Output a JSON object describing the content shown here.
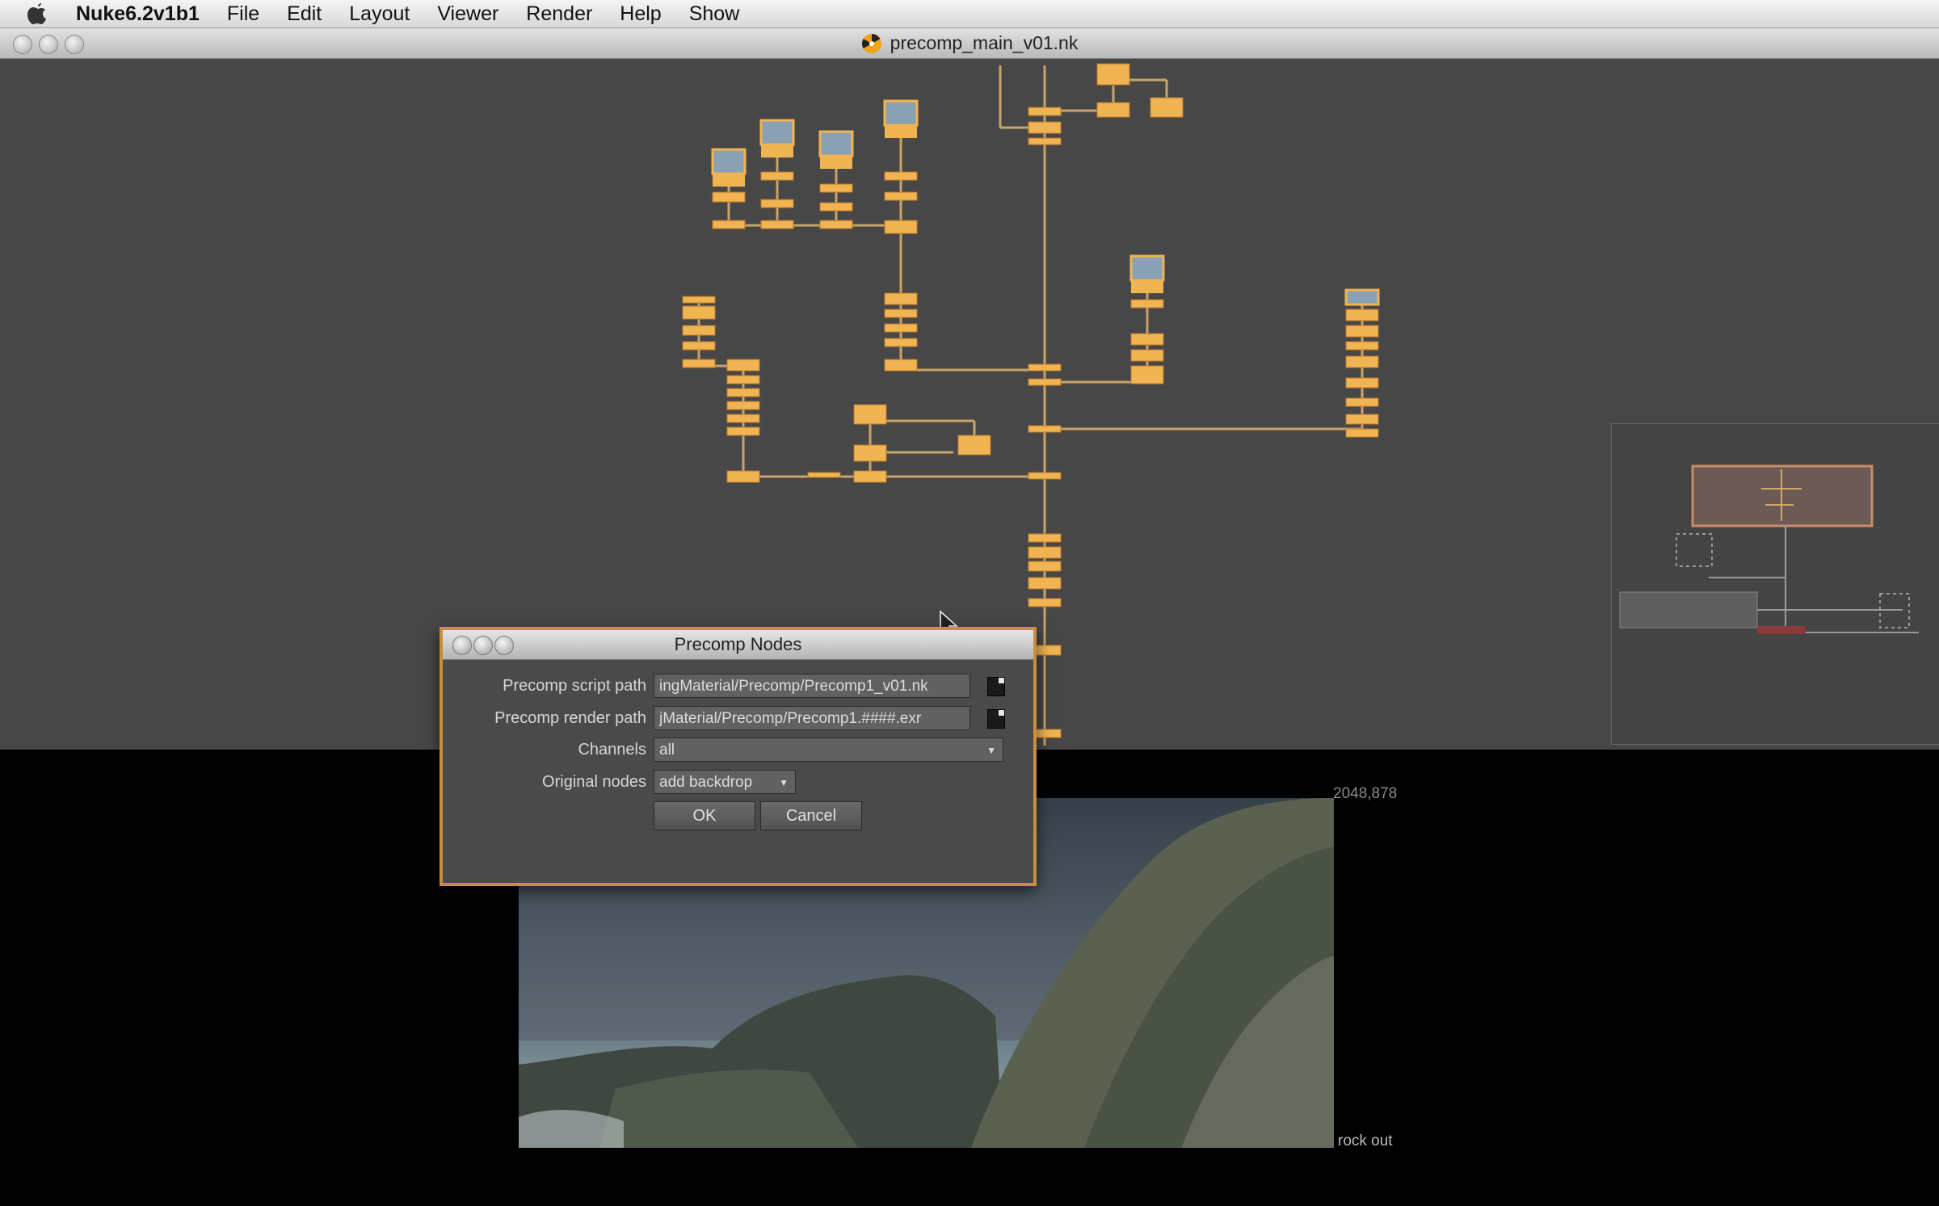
{
  "menubar": {
    "app_name": "Nuke6.2v1b1",
    "items": [
      "File",
      "Edit",
      "Layout",
      "Viewer",
      "Render",
      "Help",
      "Show"
    ]
  },
  "window": {
    "title": "precomp_main_v01.nk"
  },
  "viewer": {
    "format_label": "2048,878",
    "status_label": "rock out"
  },
  "dialog": {
    "title": "Precomp Nodes",
    "script_path_label": "Precomp script path",
    "script_path_value": "ingMaterial/Precomp/Precomp1_v01.nk",
    "render_path_label": "Precomp render path",
    "render_path_value": "jMaterial/Precomp/Precomp1.####.exr",
    "channels_label": "Channels",
    "channels_value": "all",
    "original_nodes_label": "Original nodes",
    "original_nodes_value": "add backdrop",
    "ok_label": "OK",
    "cancel_label": "Cancel"
  },
  "colors": {
    "node_orange": "#f0b452",
    "wire": "#c9a46a",
    "dialog_border": "#c78f3c",
    "dag_bg": "#474747"
  },
  "icons": [
    "apple-icon",
    "nuke-icon",
    "file-browse-icon",
    "dropdown-arrow-icon",
    "mouse-cursor-icon"
  ]
}
